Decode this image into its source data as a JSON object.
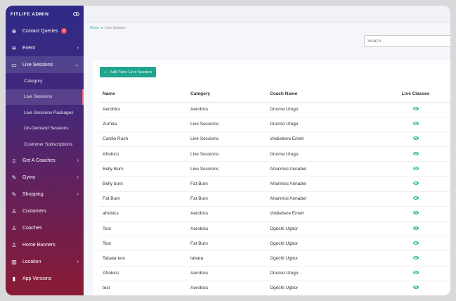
{
  "brand": "FITLIFE ADMIN",
  "sidebar": {
    "items": [
      {
        "label": "Contact Queries",
        "icon": "globe-icon",
        "badge": "0"
      },
      {
        "label": "Event",
        "icon": "layers-icon"
      },
      {
        "label": "Live Sessions",
        "icon": "video-icon"
      },
      {
        "label": "Get A Coaches",
        "icon": "tablet-icon"
      },
      {
        "label": "Gyms",
        "icon": "edit-icon"
      },
      {
        "label": "Shopping",
        "icon": "edit-icon"
      },
      {
        "label": "Customers",
        "icon": "user-icon"
      },
      {
        "label": "Coaches",
        "icon": "user-icon"
      },
      {
        "label": "Home Banners",
        "icon": "user-icon"
      },
      {
        "label": "Location",
        "icon": "map-icon"
      },
      {
        "label": "App Versions",
        "icon": "bar-chart-icon"
      }
    ],
    "sub_items": [
      {
        "label": "Category"
      },
      {
        "label": "Live Sessions"
      },
      {
        "label": "Live Sessions Packages"
      },
      {
        "label": "On-Demand Sessions"
      },
      {
        "label": "Customer Subscriptions"
      }
    ]
  },
  "breadcrumb": {
    "home": "Home",
    "sep": "▸",
    "current": "Live Session"
  },
  "search": {
    "placeholder": "Search"
  },
  "add_button": {
    "label": "Add New Live Session"
  },
  "table": {
    "columns": [
      "Name",
      "Category",
      "Coach Name",
      "Live Classes"
    ],
    "rows": [
      [
        "Aerobics",
        "Aerobics",
        "Onome Utogo"
      ],
      [
        "Zumba",
        "Live Sessions",
        "Onome Utogo"
      ],
      [
        "Cardio Rush",
        "Live Sessions",
        "chidiebere Emeh"
      ],
      [
        "Afrobics",
        "Live Sessions",
        "Onome Utogo"
      ],
      [
        "Belly Burn",
        "Live Sessions",
        "Ahanmisi Annabel"
      ],
      [
        "Belly burn",
        "Fat Burn",
        "Ahanmisi Annabel"
      ],
      [
        "Fat Burn",
        "Fat Burn",
        "Ahanmisi Annabel"
      ],
      [
        "afrobics",
        "Aerobics",
        "chidiebere Emeh"
      ],
      [
        "Test",
        "Aerobics",
        "Ogechi Ugbor"
      ],
      [
        "Test",
        "Fat Burn",
        "Ogechi Ugbor"
      ],
      [
        "Tabata test",
        "tabata",
        "Ogechi Ugbor"
      ],
      [
        "Afrobics",
        "Aerobics",
        "Onome Utogo"
      ],
      [
        "test",
        "Aerobics",
        "Ogechi Ugbor"
      ]
    ]
  },
  "colors": {
    "accent": "#20a48e",
    "eye": "#2ec29a",
    "badge": "#e84a5f"
  }
}
